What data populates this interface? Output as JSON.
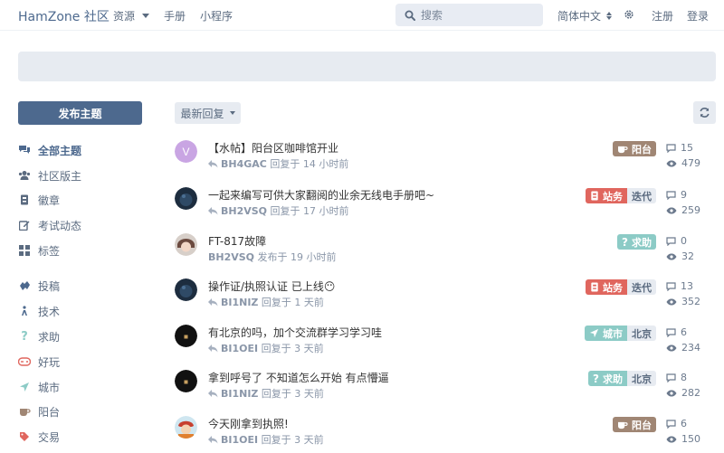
{
  "header": {
    "brand": "HamZone 社区",
    "nav": [
      {
        "label": "资源"
      },
      {
        "label": "手册"
      },
      {
        "label": "小程序"
      }
    ],
    "search_placeholder": "搜索",
    "language": "简体中文",
    "register": "注册",
    "login": "登录"
  },
  "sidebar": {
    "new_topic": "发布主题",
    "items": [
      {
        "label": "全部主题",
        "icon": "comments-icon"
      },
      {
        "label": "社区版主",
        "icon": "users-icon"
      },
      {
        "label": "徽章",
        "icon": "badge-icon"
      },
      {
        "label": "考试动态",
        "icon": "edit-icon"
      },
      {
        "label": "标签",
        "icon": "tags-grid-icon"
      },
      {
        "label": "投稿",
        "icon": "hands-icon"
      },
      {
        "label": "技术",
        "icon": "tech-icon"
      },
      {
        "label": "求助",
        "icon": "question-icon"
      },
      {
        "label": "好玩",
        "icon": "gamepad-icon"
      },
      {
        "label": "城市",
        "icon": "location-arrow-icon"
      },
      {
        "label": "阳台",
        "icon": "coffee-icon"
      },
      {
        "label": "交易",
        "icon": "tag-icon"
      }
    ]
  },
  "toolbar": {
    "sort_label": "最新回复"
  },
  "colors": {
    "primary": "#4d698e",
    "tag_balcony": "#a08674",
    "tag_site": "#e0665e",
    "tag_help": "#8ccbc6",
    "tag_city": "#8ccbc6"
  },
  "discussions": [
    {
      "title": "【水帖】阳台区咖啡馆开业",
      "user": "BH4GAC",
      "action": "回复于 14 小时前",
      "replied": true,
      "tags": [
        {
          "label": "阳台",
          "icon": "coffee-icon",
          "color": "#a08674"
        }
      ],
      "replies": "15",
      "views": "479",
      "avatar": "letter",
      "avatar_letter": "V"
    },
    {
      "title": "一起来编写可供大家翻阅的业余无线电手册吧~",
      "user": "BH2VSQ",
      "action": "回复于 17 小时前",
      "replied": true,
      "tags": [
        {
          "label": "站务",
          "icon": "id-card-icon",
          "color": "#e0665e"
        },
        {
          "label": "迭代"
        }
      ],
      "replies": "9",
      "views": "259",
      "avatar": "dark"
    },
    {
      "title": "FT-817故障",
      "user": "BH2VSQ",
      "action": "发布于 19 小时前",
      "replied": false,
      "tags": [
        {
          "label": "求助",
          "icon": "question-icon",
          "color": "#8ccbc6"
        }
      ],
      "replies": "0",
      "views": "32",
      "avatar": "anime"
    },
    {
      "title": "操作证/执照认证 已上线😶",
      "user": "BI1NIZ",
      "action": "回复于 1 天前",
      "replied": true,
      "tags": [
        {
          "label": "站务",
          "icon": "id-card-icon",
          "color": "#e0665e"
        },
        {
          "label": "迭代"
        }
      ],
      "replies": "13",
      "views": "352",
      "avatar": "dark"
    },
    {
      "title": "有北京的吗，加个交流群学习学习哇",
      "user": "BI1OEI",
      "action": "回复于 3 天前",
      "replied": true,
      "tags": [
        {
          "label": "城市",
          "icon": "location-arrow-icon",
          "color": "#8ccbc6"
        },
        {
          "label": "北京"
        }
      ],
      "replies": "6",
      "views": "234",
      "avatar": "black"
    },
    {
      "title": "拿到呼号了 不知道怎么开始 有点懵逼",
      "user": "BI1NIZ",
      "action": "回复于 3 天前",
      "replied": true,
      "tags": [
        {
          "label": "求助",
          "icon": "question-icon",
          "color": "#8ccbc6"
        },
        {
          "label": "北京"
        }
      ],
      "replies": "8",
      "views": "282",
      "avatar": "black"
    },
    {
      "title": "今天刚拿到执照!",
      "user": "BI1OEI",
      "action": "回复于 3 天前",
      "replied": true,
      "tags": [
        {
          "label": "阳台",
          "icon": "coffee-icon",
          "color": "#a08674"
        }
      ],
      "replies": "6",
      "views": "150",
      "avatar": "cartoon"
    }
  ]
}
